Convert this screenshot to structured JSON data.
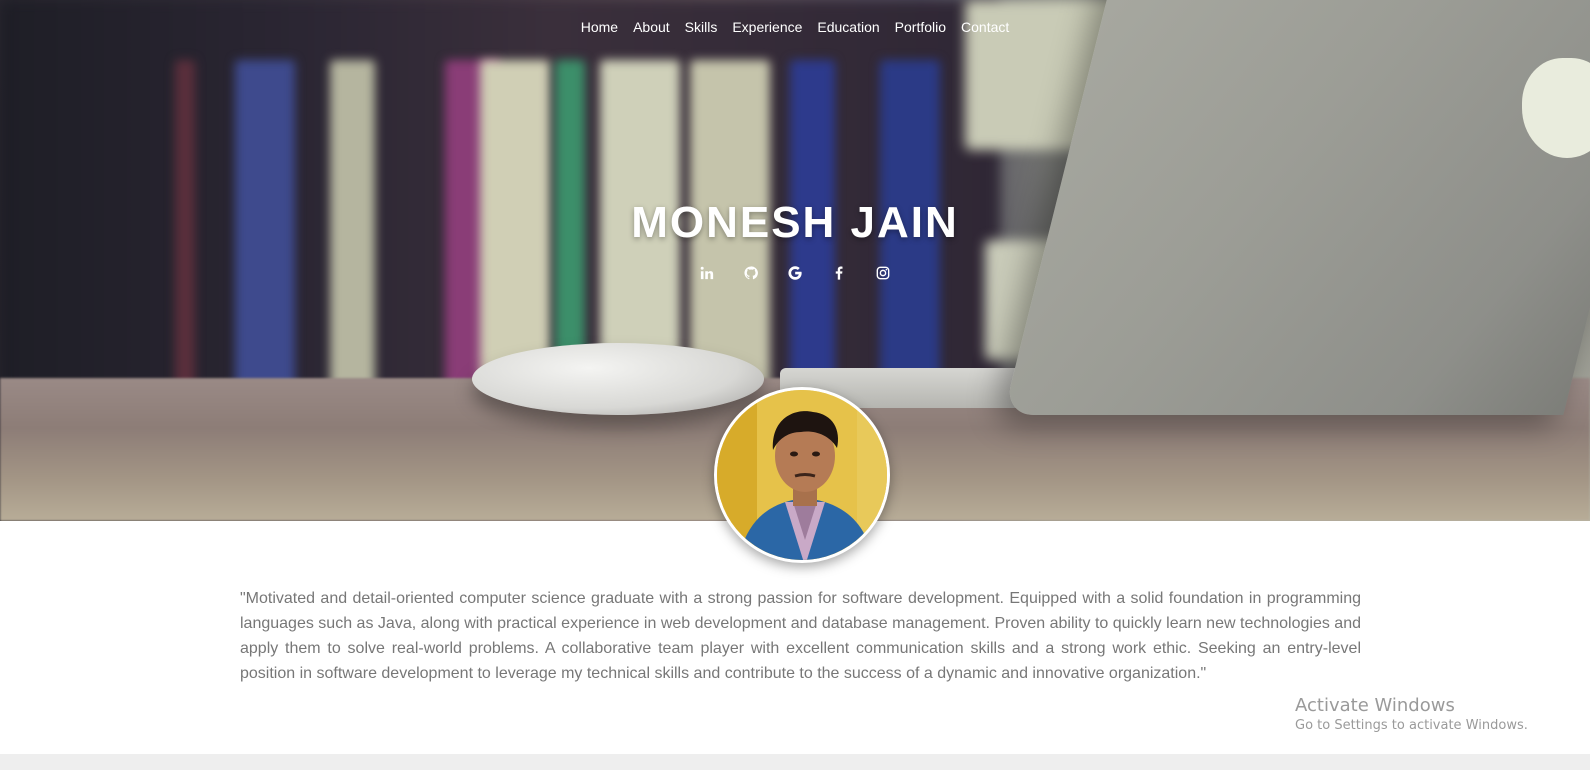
{
  "nav": {
    "items": [
      {
        "label": "Home"
      },
      {
        "label": "About"
      },
      {
        "label": "Skills"
      },
      {
        "label": "Experience"
      },
      {
        "label": "Education"
      },
      {
        "label": "Portfolio"
      },
      {
        "label": "Contact"
      }
    ]
  },
  "hero": {
    "name": "MONESH JAIN",
    "social_icons": [
      "linkedin-icon",
      "github-icon",
      "google-icon",
      "facebook-icon",
      "instagram-icon"
    ]
  },
  "about": {
    "text": "\"Motivated and detail-oriented computer science graduate with a strong passion for software development. Equipped with a solid foundation in programming languages such as Java, along with practical experience in web development and database management. Proven ability to quickly learn new technologies and apply them to solve real-world problems. A collaborative team player with excellent communication skills and a strong work ethic. Seeking an entry-level position in software development to leverage my technical skills and contribute to the success of a dynamic and innovative organization.\""
  },
  "watermark": {
    "title": "Activate Windows",
    "subtitle": "Go to Settings to activate Windows."
  },
  "colors": {
    "text_muted": "#777777",
    "hero_text": "#ffffff",
    "footer_bar": "#eeeeee"
  }
}
